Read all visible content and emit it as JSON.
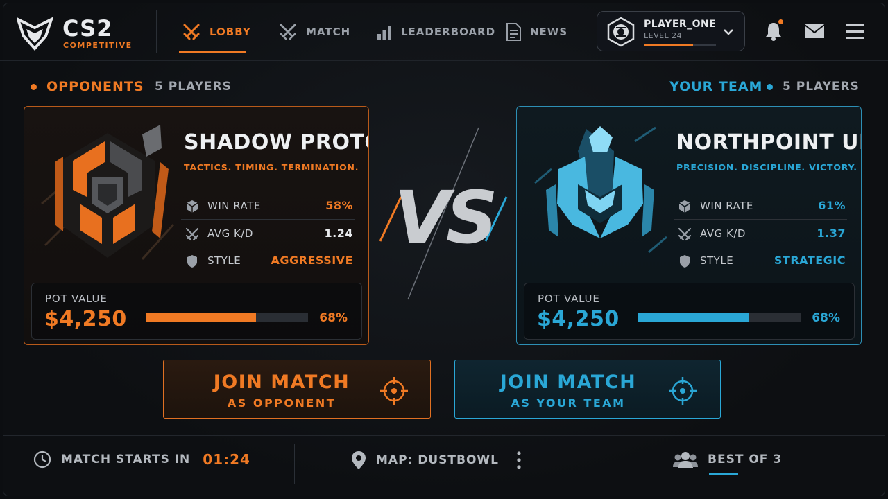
{
  "app": {
    "title": "CS2",
    "subtitle": "COMPETITIVE"
  },
  "nav": [
    {
      "label": "LOBBY",
      "icon": "crossed-swords-icon",
      "active": true
    },
    {
      "label": "MATCH",
      "icon": "crossed-knives-icon",
      "active": false
    },
    {
      "label": "LEADERBOARD",
      "icon": "bar-chart-icon",
      "active": false
    },
    {
      "label": "NEWS",
      "icon": "document-icon",
      "active": false
    }
  ],
  "profile": {
    "name": "PLAYER_ONE",
    "level": "LEVEL 24",
    "level_progress": 0.68
  },
  "header_icons": [
    "bell-icon",
    "mail-icon",
    "menu-icon"
  ],
  "opponents": {
    "section_label": "OPPONENTS",
    "players": "5 PLAYERS",
    "name": "SHADOW PROTOCOL",
    "tagline": "TACTICS. TIMING. TERMINATION.",
    "stats": [
      {
        "label": "WIN RATE",
        "value": "58%",
        "icon": "cube-icon"
      },
      {
        "label": "AVG K/D",
        "value": "1.24",
        "icon": "crossed-swords-icon"
      },
      {
        "label": "STYLE",
        "value": "AGGRESSIVE",
        "icon": "shield-icon"
      }
    ],
    "pot_label": "POT VALUE",
    "pot_value": "$4,250",
    "pot_pct": "68%",
    "pot_fill": 0.68
  },
  "your_team": {
    "section_label": "YOUR TEAM",
    "players": "5 PLAYERS",
    "name": "NORTHPOINT UNIT",
    "tagline": "PRECISION. DISCIPLINE. VICTORY.",
    "stats": [
      {
        "label": "WIN RATE",
        "value": "61%",
        "icon": "cube-icon"
      },
      {
        "label": "AVG K/D",
        "value": "1.37",
        "icon": "crossed-swords-icon"
      },
      {
        "label": "STYLE",
        "value": "STRATEGIC",
        "icon": "shield-icon"
      }
    ],
    "pot_label": "POT VALUE",
    "pot_value": "$4,250",
    "pot_pct": "68%",
    "pot_fill": 0.68
  },
  "vs_label": "VS",
  "join_opponent": {
    "title": "JOIN MATCH",
    "sub": "AS OPPONENT"
  },
  "join_team": {
    "title": "JOIN MATCH",
    "sub": "AS YOUR TEAM"
  },
  "footer": {
    "starts_label": "MATCH STARTS IN",
    "countdown": "01:24",
    "map_label": "MAP: DUSTBOWL",
    "best_of": "BEST OF 3"
  },
  "colors": {
    "orange": "#f07a24",
    "blue": "#2aa7d6",
    "bg": "#0c0e11"
  }
}
